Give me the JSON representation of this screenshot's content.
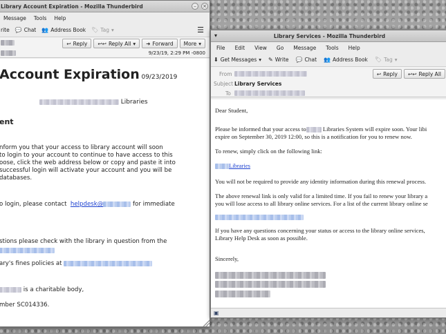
{
  "left_window": {
    "title": "Library Account Expiration - Mozilla Thunderbird",
    "menu": [
      "Message",
      "Tools",
      "Help"
    ],
    "toolbar": {
      "write": "rite",
      "chat": "Chat",
      "address_book": "Address Book",
      "tag": "Tag",
      "menu_icon": "menu-icon"
    },
    "actions": {
      "reply": "Reply",
      "reply_all": "Reply All",
      "forward": "Forward",
      "more": "More"
    },
    "date": "9/23/19, 2:29 PM -0800",
    "body": {
      "heading": "Account Expiration",
      "heading_date": "09/23/2019",
      "libraries": "Libraries",
      "subheading": "ent",
      "p1_l1": "nform you that your access to library account will soon",
      "p1_l2": "to login to your account to continue to have access to this",
      "p1_l3": "oose, click the web address below or copy and paste it into",
      "p1_l4": "successful login will activate your account and you will be",
      "p1_l5": "databases.",
      "p2_prefix": "o login, please contact",
      "p2_link": "helpdesk@",
      "p2_suffix": "for immediate",
      "p3": "stions please check with the library in question from the",
      "p4": "ary's fines policies at",
      "p5": "is a charitable body,",
      "p6": "mber SC014336."
    }
  },
  "right_window": {
    "title": "Library Services - Mozilla Thunderbird",
    "menu": [
      "File",
      "Edit",
      "View",
      "Go",
      "Message",
      "Tools",
      "Help"
    ],
    "toolbar": {
      "get_messages": "Get Messages",
      "write": "Write",
      "chat": "Chat",
      "address_book": "Address Book",
      "tag": "Tag"
    },
    "header": {
      "from_label": "From",
      "subject_label": "Subject",
      "subject": "Library Services",
      "to_label": "To"
    },
    "actions": {
      "reply": "Reply",
      "reply_all": "Reply All"
    },
    "body": {
      "greeting": "Dear Student,",
      "p1_a": "Please be informed that your access to",
      "p1_b": "Libraries System will expire soon. Your libi",
      "p1_c": "expire on September 30, 2019 12:00, so this is a notification for you to renew now.",
      "p2": "To renew, simply click on the following link:",
      "link": "Libraries",
      "p3": "You will not be required to provide any identity information during this renewal process.",
      "p4_a": "The above renewal link is only valid for a limited time. If you fail to renew your library a",
      "p4_b": "you will lose access to all library online services. For a list of the current library online se",
      "p5_a": "If you have any questions concerning your status or access to the library online services,",
      "p5_b": "Library Help Desk as soon as possible.",
      "closing": "Sincerely,"
    }
  }
}
